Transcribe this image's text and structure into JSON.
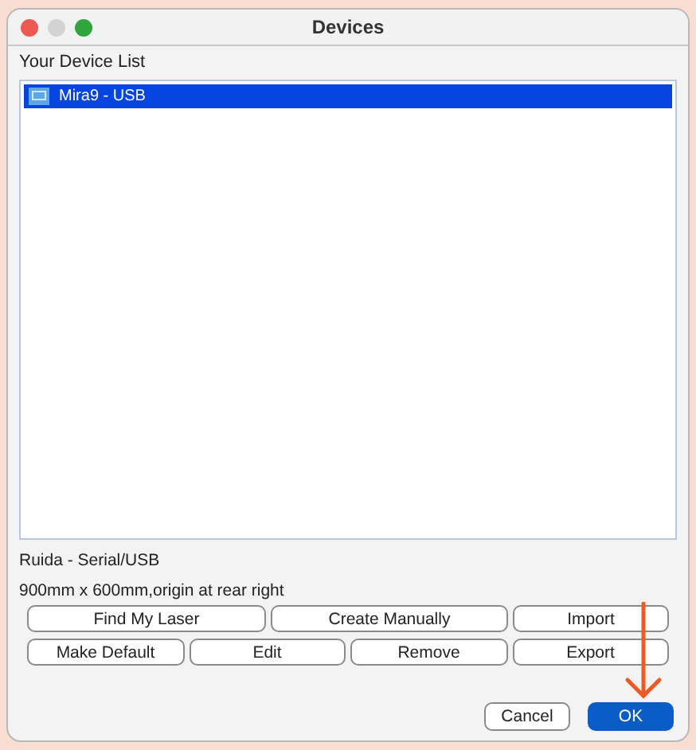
{
  "window": {
    "title": "Devices"
  },
  "device_list": {
    "label": "Your Device List",
    "items": [
      {
        "name": "Mira9 - USB",
        "selected": true
      }
    ]
  },
  "device_info": [
    "Ruida - Serial/USB",
    "900mm x 600mm,origin at rear right"
  ],
  "action_buttons": [
    [
      "Find My Laser",
      "Create Manually",
      "Import"
    ],
    [
      "Make Default",
      "Edit",
      "Remove",
      "Export"
    ]
  ],
  "dialog_buttons": [
    {
      "label": "Cancel",
      "default": false
    },
    {
      "label": "OK",
      "default": true
    }
  ]
}
